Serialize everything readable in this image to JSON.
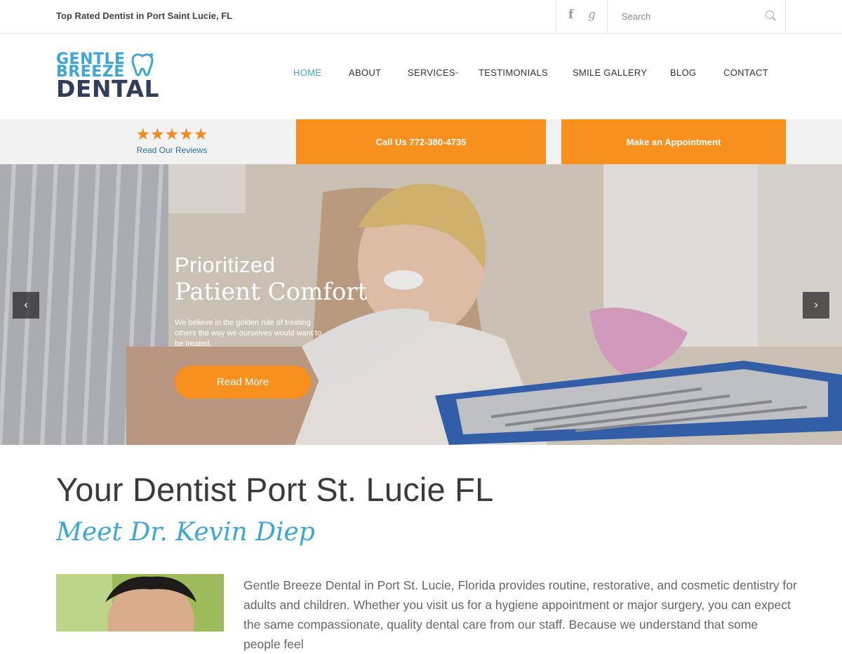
{
  "topbar": {
    "tagline": "Top Rated Dentist in Port Saint Lucie, FL",
    "social": {
      "facebook_icon": "facebook-icon",
      "google_plus_icon": "google-plus-icon"
    },
    "search": {
      "placeholder": "Search",
      "value": ""
    }
  },
  "header": {
    "logo": {
      "line1": "GENTLE",
      "line2": "BREEZE",
      "line3": "DENTAL"
    },
    "nav": [
      {
        "label": "HOME",
        "active": true
      },
      {
        "label": "ABOUT"
      },
      {
        "label": "SERVICES",
        "has_dropdown": true
      },
      {
        "label": "TESTIMONIALS"
      },
      {
        "label": "SMILE GALLERY"
      },
      {
        "label": "BLOG"
      },
      {
        "label": "CONTACT"
      }
    ]
  },
  "cta": {
    "stars": "★★★★★",
    "rating": 5,
    "reviews_label": "Read Our Reviews",
    "call_label": "Call Us 772-380-4735",
    "appointment_label": "Make an Appointment"
  },
  "hero": {
    "title_line1": "Prioritized",
    "title_line2": "Patient Comfort",
    "description": "We believe in the golden rule of treating others the way we ourselves would want to be treated.",
    "button_label": "Read More",
    "prev_icon": "‹",
    "next_icon": "›"
  },
  "content": {
    "heading": "Your Dentist Port St. Lucie FL",
    "subheading": "Meet Dr. Kevin Diep",
    "paragraph": "Gentle Breeze Dental in Port St. Lucie, Florida provides routine, restorative, and cosmetic dentistry for adults and children. Whether you visit us for a hygiene appointment or major surgery, you can expect the same compassionate, quality dental care from our staff. Because we understand that some people feel"
  },
  "colors": {
    "accent_blue": "#3aa6d9",
    "orange": "#f7901e",
    "navy": "#2f3e5b"
  }
}
